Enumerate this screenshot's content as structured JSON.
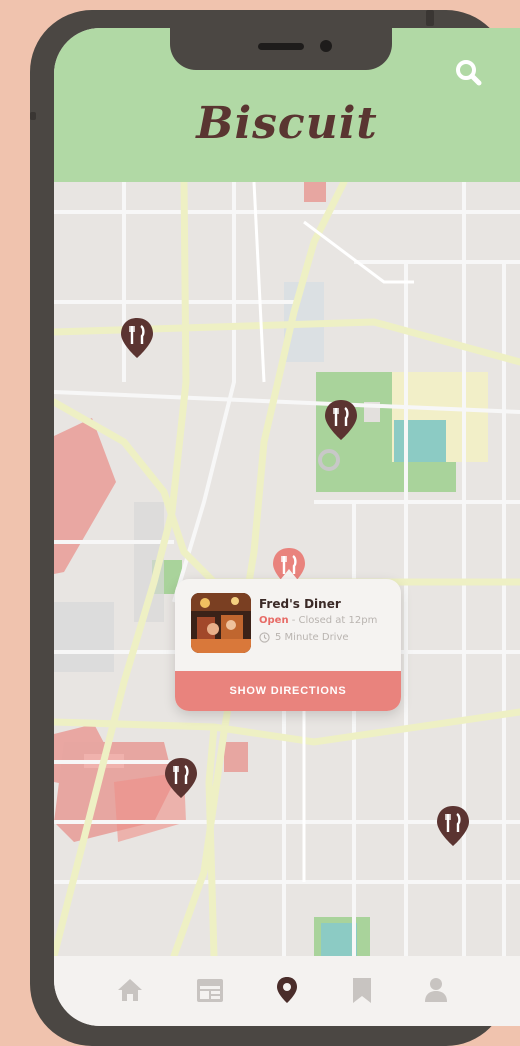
{
  "app": {
    "title": "Biscuit"
  },
  "header": {
    "search_icon": "search-icon"
  },
  "popup": {
    "name": "Fred's Diner",
    "status_open": "Open",
    "status_rest": " - Closed at 12pm",
    "drive_time": "5 Minute Drive",
    "directions_label": "SHOW DIRECTIONS"
  },
  "map": {
    "pins": [
      {
        "name": "restaurant-pin-1",
        "active": false
      },
      {
        "name": "restaurant-pin-2",
        "active": false
      },
      {
        "name": "restaurant-pin-selected",
        "active": true
      },
      {
        "name": "restaurant-pin-3",
        "active": false
      },
      {
        "name": "restaurant-pin-4",
        "active": false
      }
    ]
  },
  "nav": {
    "items": [
      {
        "icon": "home-icon",
        "active": false
      },
      {
        "icon": "calendar-icon",
        "active": false
      },
      {
        "icon": "map-pin-icon",
        "active": true
      },
      {
        "icon": "bookmark-icon",
        "active": false
      },
      {
        "icon": "profile-icon",
        "active": false
      }
    ]
  },
  "colors": {
    "header_bg": "#b1d9a5",
    "brand_text": "#5a3531",
    "accent": "#e9837d",
    "pin_default": "#5b3431",
    "pin_active": "#e9837d",
    "open_status": "#e76b66"
  }
}
